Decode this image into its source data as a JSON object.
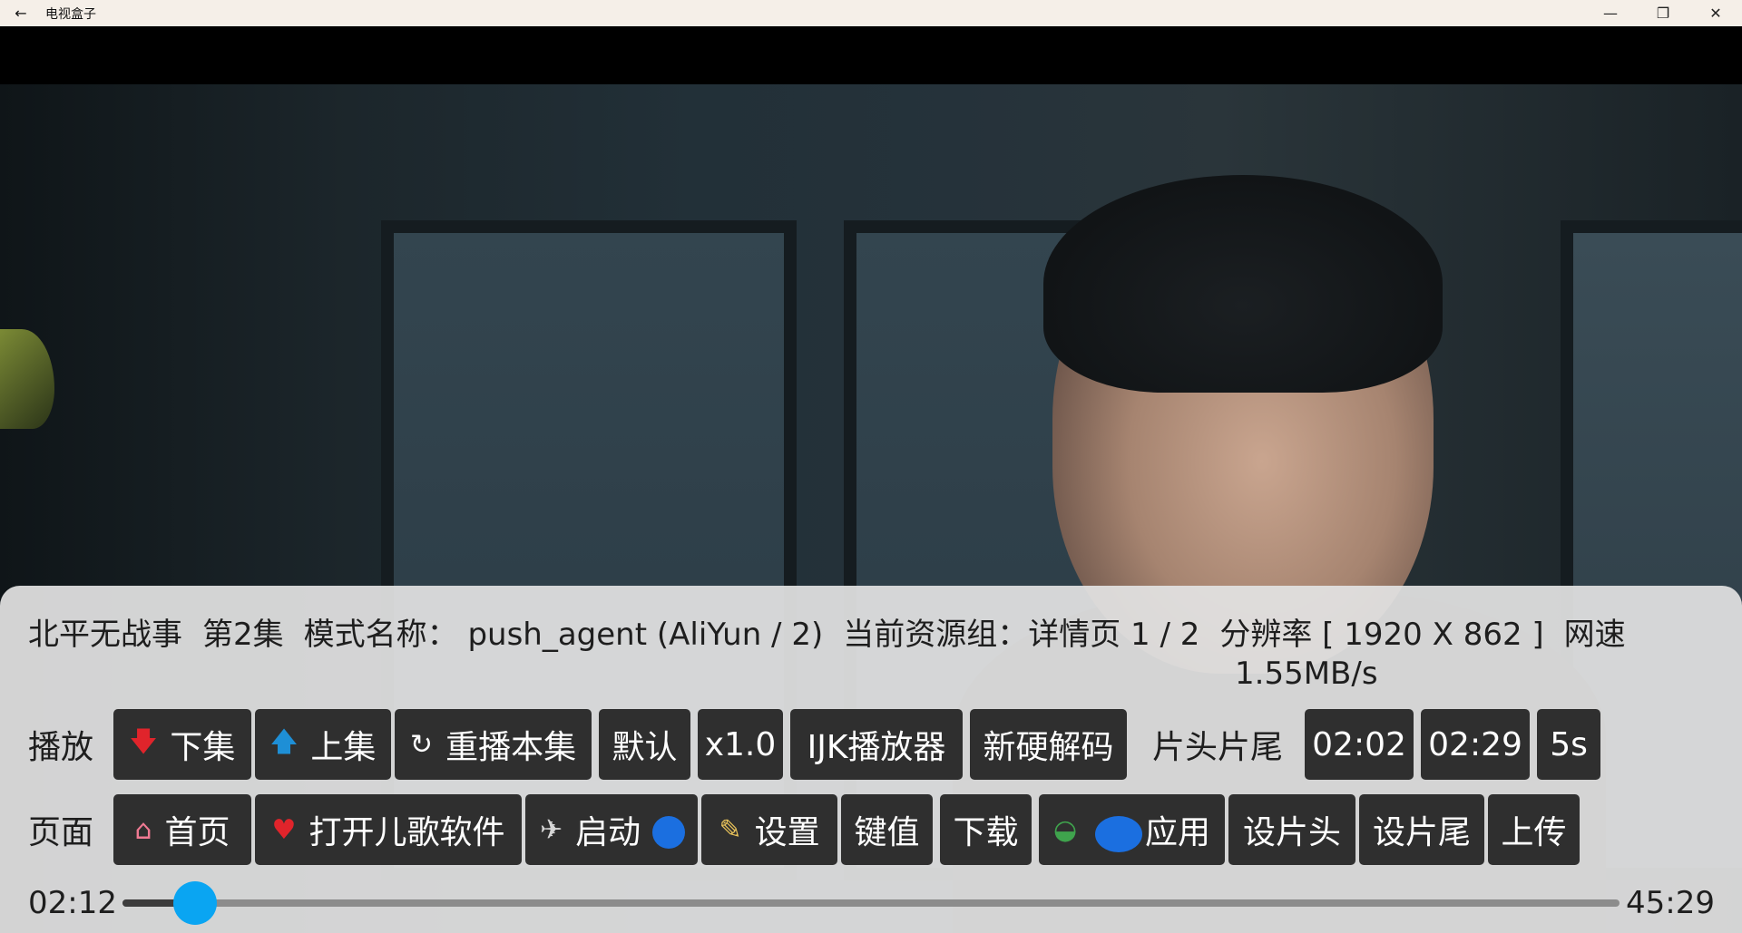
{
  "window": {
    "title": "电视盒子",
    "back_icon": "←",
    "minimize_icon": "—",
    "restore_icon": "❐",
    "close_icon": "✕"
  },
  "info": {
    "title": "北平无战事",
    "episode": "第2集",
    "mode": "模式名称： push_agent (AliYun / 2)",
    "source_group": "当前资源组：详情页 1 / 2",
    "resolution": "分辨率 [ 1920 X 862 ]",
    "speed_label": "网速",
    "speed_value": "1.55MB/s"
  },
  "play_row": {
    "label": "播放",
    "next": {
      "icon": "down-arrow-icon",
      "glyph": "🡇",
      "label": "下集"
    },
    "prev": {
      "icon": "up-arrow-icon",
      "glyph": "🡅",
      "label": "上集"
    },
    "replay": {
      "icon": "replay-icon",
      "glyph": "↻",
      "label": "重播本集"
    },
    "scale": "默认",
    "speed": "x1.0",
    "player": "IJK播放器",
    "decoder": "新硬解码",
    "intro_outro_label": "片头片尾",
    "intro_time": "02:02",
    "outro_time": "02:29",
    "step": "5s"
  },
  "page_row": {
    "label": "页面",
    "home": {
      "icon": "house-icon",
      "glyph": "⌂",
      "label": "首页"
    },
    "kids": {
      "icon": "heart-icon",
      "glyph": "♥",
      "label": "打开儿歌软件"
    },
    "launch": {
      "icon": "airplane-icon",
      "glyph": "✈",
      "label": "启动"
    },
    "settings": {
      "icon": "tools-icon",
      "glyph": "✎",
      "label": "设置"
    },
    "keys": "键值",
    "download": "下载",
    "apps": {
      "icon": "watermelon-icon",
      "glyph": "◒",
      "label": "应用"
    },
    "set_intro": "设片头",
    "set_outro": "设片尾",
    "upload": "上传"
  },
  "progress": {
    "current": "02:12",
    "total": "45:29",
    "fraction": 0.0484
  },
  "colors": {
    "accent": "#0aa5f2",
    "button_bg": "#2f2f2f",
    "panel_bg": "#e2e2e2",
    "red_icon": "#e0242b",
    "blue_icon": "#1e8fd6"
  }
}
